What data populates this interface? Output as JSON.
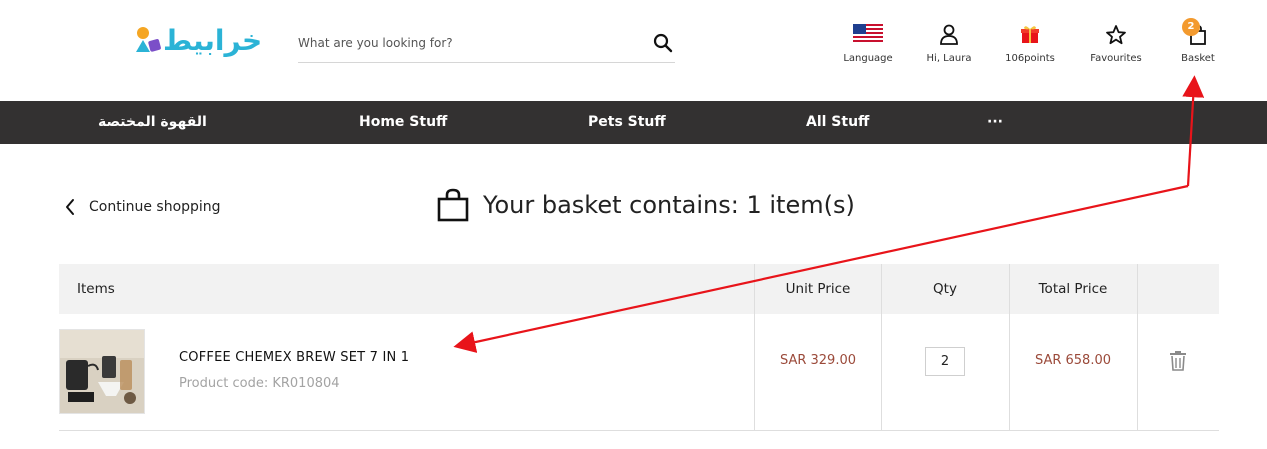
{
  "header": {
    "logo_text": "خرابيط",
    "search": {
      "placeholder": "What are you looking for?",
      "value": ""
    },
    "items": [
      {
        "label": "Language",
        "icon": "us-flag-icon"
      },
      {
        "label": "Hi, Laura",
        "icon": "user-icon"
      },
      {
        "label": "106points",
        "icon": "gift-icon"
      },
      {
        "label": "Favourites",
        "icon": "star-icon"
      },
      {
        "label": "Basket",
        "icon": "basket-icon",
        "badge": "2"
      }
    ]
  },
  "nav": {
    "items": [
      "القهوة المختصة",
      "Home Stuff",
      "Pets Stuff",
      "All Stuff",
      "···"
    ]
  },
  "basket": {
    "continue_label": "Continue shopping",
    "title": "Your basket contains: 1 item(s)"
  },
  "table": {
    "headers": [
      "Items",
      "Unit Price",
      "Qty",
      "Total Price"
    ],
    "rows": [
      {
        "name": "COFFEE CHEMEX BREW SET 7 IN 1",
        "code": "Product code: KR010804",
        "unit_price": "SAR 329.00",
        "qty": "2",
        "total_price": "SAR 658.00"
      }
    ]
  },
  "colors": {
    "nav_bg": "#333131",
    "price": "#9b4a3a",
    "badge": "#f39a2e",
    "annotation_arrow": "#e8141a",
    "logo_accent": "#2bb3d6"
  }
}
